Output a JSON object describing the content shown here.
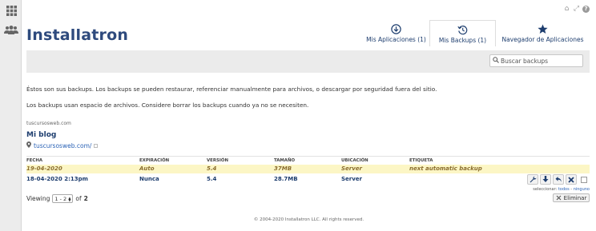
{
  "sidebar": {
    "icons": [
      "apps-grid-icon",
      "users-icon"
    ]
  },
  "header": {
    "logo": "Installatron",
    "tools": [
      "home-icon",
      "expand-icon",
      "help-icon"
    ],
    "tabs": [
      {
        "label": "Mis Aplicaciones (1)",
        "icon": "download-circle-icon",
        "active": false
      },
      {
        "label": "Mis Backups (1)",
        "icon": "history-icon",
        "active": true
      },
      {
        "label": "Navegador de Aplicaciones",
        "icon": "star-icon",
        "active": false
      }
    ]
  },
  "search": {
    "placeholder": "Buscar backups"
  },
  "intro": {
    "line1": "Éstos son sus backups. Los backups se pueden restaurar, referenciar manualmente para archivos, o descargar por seguridad fuera del sitio.",
    "line2": "Los backups usan espacio de archivos. Considere borrar los backups cuando ya no se necesiten."
  },
  "site": {
    "domain": "tuscursosweb.com",
    "app_name": "Mi blog",
    "link": "tuscursosweb.com/"
  },
  "table": {
    "columns": [
      "FECHA",
      "EXPIRACIÓN",
      "VERSIÓN",
      "TAMAÑO",
      "UBICACIÓN",
      "ETIQUETA"
    ],
    "rows": [
      {
        "fecha": "19-04-2020",
        "expiracion": "Auto",
        "version": "5.4",
        "tamano": "37MB",
        "ubicacion": "Server",
        "etiqueta": "next automatic backup"
      },
      {
        "fecha": "18-04-2020 2:13pm",
        "expiracion": "Nunca",
        "version": "5.4",
        "tamano": "28.7MB",
        "ubicacion": "Server",
        "etiqueta": ""
      }
    ]
  },
  "selection": {
    "prefix": "seleccionar:",
    "all": "todos",
    "sep": "-",
    "none": "ninguno"
  },
  "pagination": {
    "viewing": "Viewing",
    "range": "1 - 2",
    "of": "of",
    "total": "2"
  },
  "delete_label": "Eliminar",
  "footer": "© 2004-2020 Installatron LLC. All rights reserved.",
  "colors": {
    "brand": "#2e4a7d",
    "link": "#2a62b6",
    "highlight": "#fcf6c5"
  }
}
